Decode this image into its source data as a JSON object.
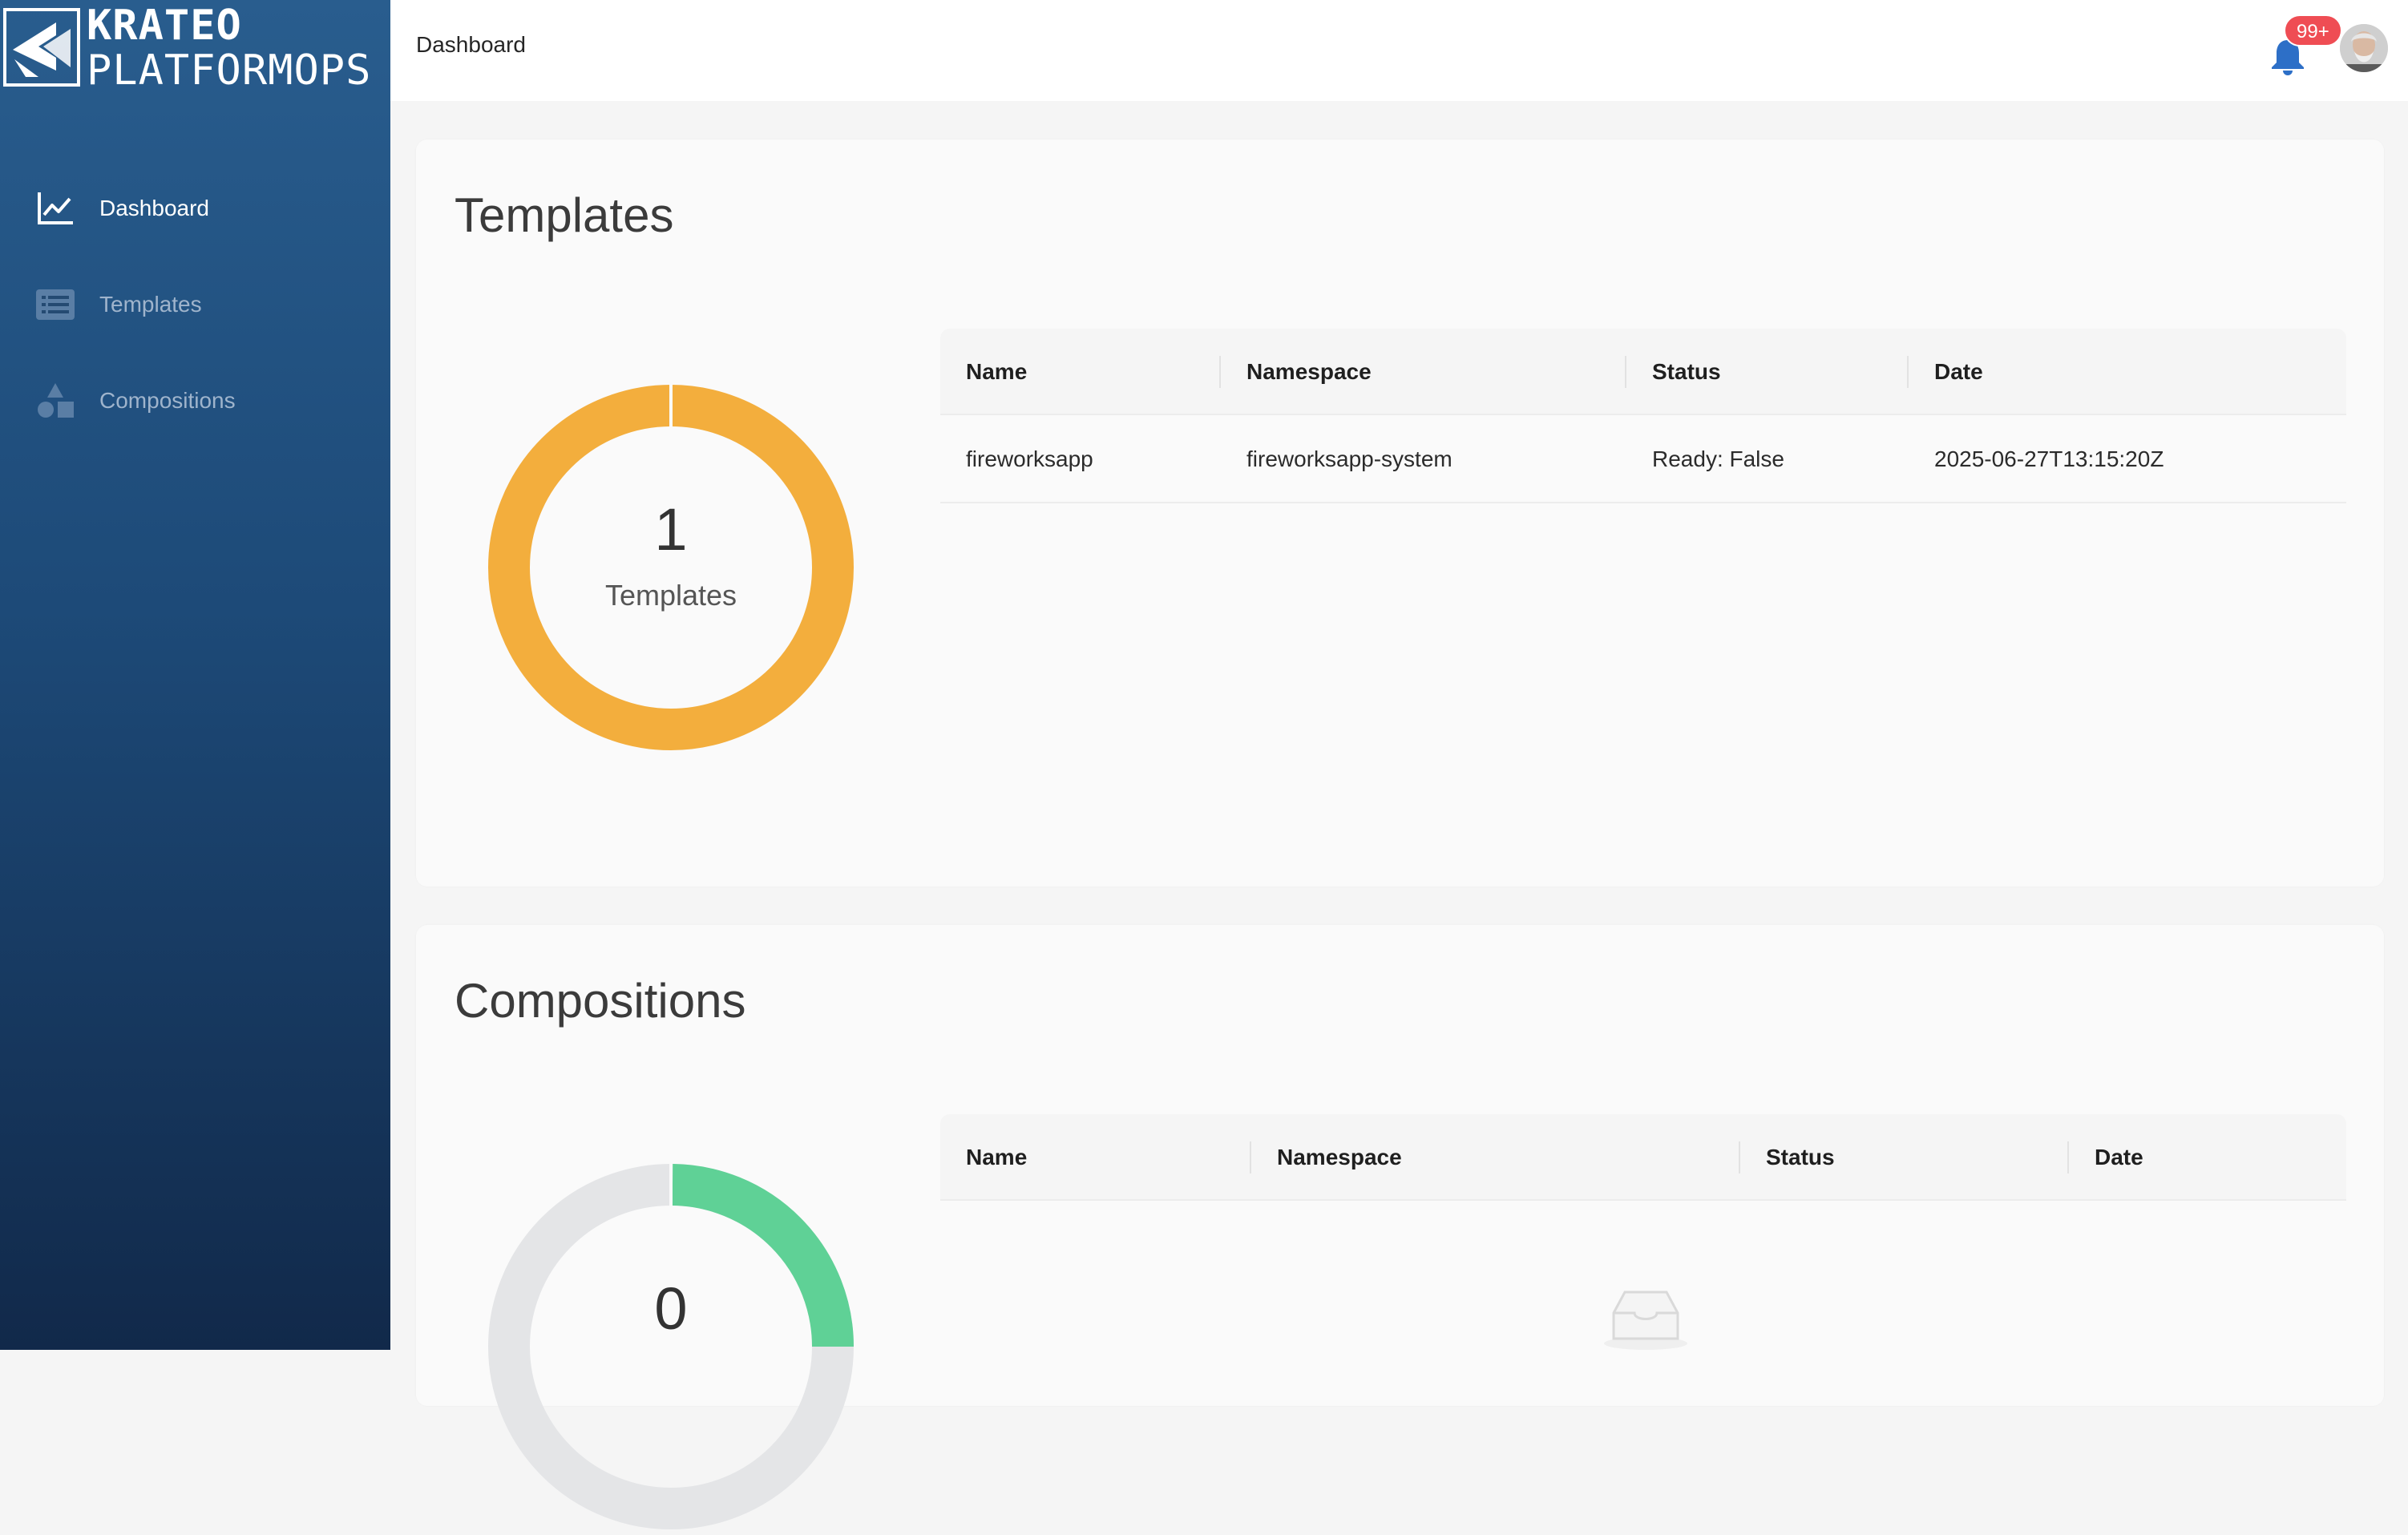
{
  "brand": {
    "line1": "KRATEO",
    "line2": "PLATFORMOPS"
  },
  "sidebar": {
    "items": [
      {
        "label": "Dashboard",
        "icon": "line-chart-icon",
        "active": true
      },
      {
        "label": "Templates",
        "icon": "list-icon",
        "active": false
      },
      {
        "label": "Compositions",
        "icon": "shapes-icon",
        "active": false
      }
    ]
  },
  "header": {
    "breadcrumb": "Dashboard",
    "notifications_badge": "99+"
  },
  "templates": {
    "title": "Templates",
    "count": "1",
    "count_label": "Templates",
    "columns": [
      "Name",
      "Namespace",
      "Status",
      "Date"
    ],
    "rows": [
      [
        "fireworksapp",
        "fireworksapp-system",
        "Ready: False",
        "2025-06-27T13:15:20Z"
      ]
    ]
  },
  "compositions": {
    "title": "Compositions",
    "count": "0",
    "columns": [
      "Name",
      "Namespace",
      "Status",
      "Date"
    ],
    "rows": []
  },
  "colors": {
    "templates_ring": "#f3ae3d",
    "compositions_ring": "#5fd196",
    "ring_empty": "#e4e5e7",
    "badge": "#ef4d54",
    "bell": "#2d6fc7"
  }
}
